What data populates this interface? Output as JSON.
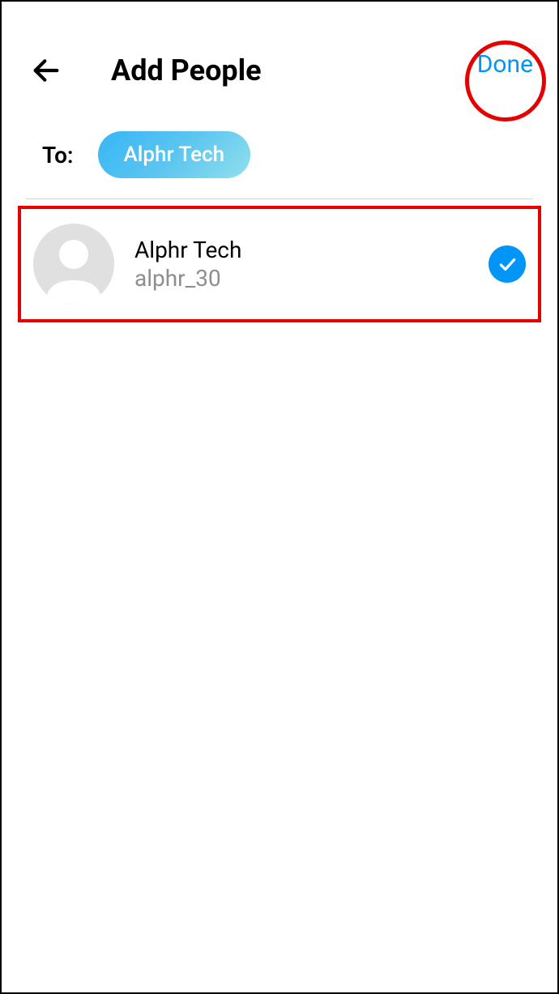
{
  "header": {
    "title": "Add People",
    "done_label": "Done"
  },
  "to_section": {
    "label": "To:",
    "chips": [
      {
        "name": "Alphr Tech"
      }
    ]
  },
  "people": [
    {
      "name": "Alphr Tech",
      "handle": "alphr_30",
      "selected": true
    }
  ]
}
